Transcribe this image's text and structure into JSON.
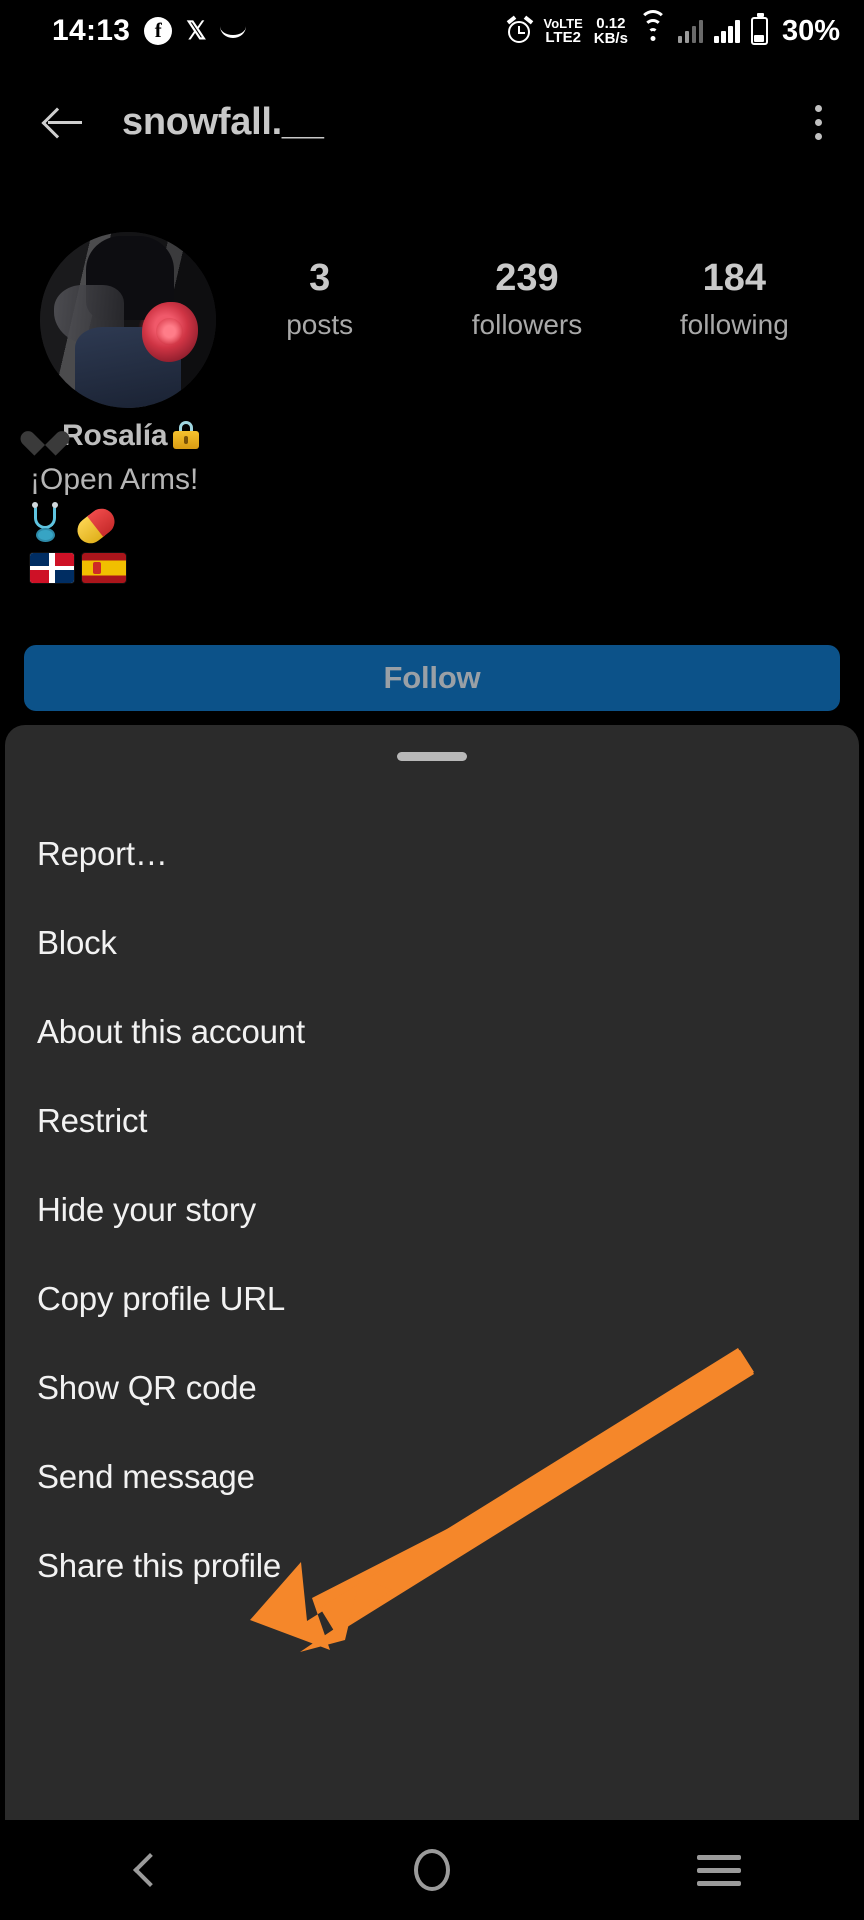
{
  "status_bar": {
    "time": "14:13",
    "icons_left": [
      "facebook-icon",
      "x-twitter-icon",
      "swoosh-icon"
    ],
    "alarm_icon": "alarm-icon",
    "volte": {
      "line1": "VoLTE",
      "line2": "LTE2"
    },
    "network_speed": {
      "value": "0.12",
      "unit": "KB/s"
    },
    "wifi_icon": "wifi-icon",
    "signal_icons": [
      "signal-bars-sim1",
      "signal-bars-sim2"
    ],
    "battery_percent": "30%"
  },
  "app_bar": {
    "back_icon": "back-arrow-icon",
    "title": "snowfall.__",
    "menu_icon": "kebab-menu-icon"
  },
  "profile": {
    "avatar_alt": "profile-picture",
    "stats": [
      {
        "number": "3",
        "label": "posts"
      },
      {
        "number": "239",
        "label": "followers"
      },
      {
        "number": "184",
        "label": "following"
      }
    ],
    "bio": {
      "name": "Rosalía",
      "name_prefix_emoji": "black-heart-emoji",
      "name_suffix_emoji": "locked-emoji",
      "lines": [
        "¡Open Arms!"
      ],
      "emoji_row_1": [
        "stethoscope-emoji",
        "pill-emoji"
      ],
      "emoji_row_2": [
        "flag-dominican-republic-emoji",
        "flag-spain-emoji"
      ]
    },
    "follow_button": "Follow"
  },
  "bottom_sheet": {
    "handle": "drag-handle",
    "items": [
      {
        "label": "Report…",
        "name": "report"
      },
      {
        "label": "Block",
        "name": "block"
      },
      {
        "label": "About this account",
        "name": "about-this-account"
      },
      {
        "label": "Restrict",
        "name": "restrict"
      },
      {
        "label": "Hide your story",
        "name": "hide-your-story"
      },
      {
        "label": "Copy profile URL",
        "name": "copy-profile-url"
      },
      {
        "label": "Show QR code",
        "name": "show-qr-code"
      },
      {
        "label": "Send message",
        "name": "send-message"
      },
      {
        "label": "Share this profile",
        "name": "share-this-profile"
      }
    ]
  },
  "annotation": {
    "type": "arrow",
    "color": "#F5872A",
    "points_to": "Send message"
  },
  "nav_bar": {
    "back": "nav-back-icon",
    "home": "nav-home-icon",
    "recents": "nav-recents-icon"
  },
  "colors": {
    "background": "#000000",
    "sheet_background": "#2b2b2b",
    "follow_button": "#0c5289",
    "annotation_orange": "#F5872A"
  }
}
